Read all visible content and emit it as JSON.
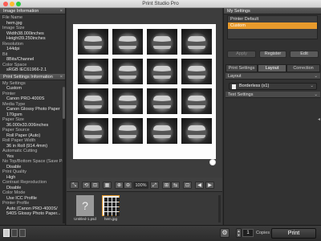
{
  "window": {
    "title": "Print Studio Pro"
  },
  "left_panel": {
    "image_info": {
      "heading": "Image Information",
      "close_label": "×",
      "rows": [
        {
          "label": "File Name",
          "value": "hem.jpg"
        },
        {
          "label": "Image Size",
          "value": "Width38.000inches"
        },
        {
          "label": "",
          "value": "Height39.250inches"
        },
        {
          "label": "Resolution",
          "value": "144dpi"
        },
        {
          "label": "Bit",
          "value": "8Bits/Channel"
        },
        {
          "label": "Color Space",
          "value": "sRGB IEC61966-2.1"
        }
      ]
    },
    "print_settings_info": {
      "heading": "Print Settings Information",
      "close_label": "×",
      "rows": [
        {
          "label": "My Settings",
          "value": "Custom"
        },
        {
          "label": "Printer",
          "value": "Canon PRO-4000S"
        },
        {
          "label": "Media Type",
          "value": "Canon Glossy Photo Paper"
        },
        {
          "label": "",
          "value": "170gsm"
        },
        {
          "label": "Paper Size",
          "value": "36.000x33.006inches"
        },
        {
          "label": "Paper Source",
          "value": "Roll Paper (Auto)"
        },
        {
          "label": "Roll Paper Width",
          "value": "36 in Roll (914.4mm)"
        },
        {
          "label": "Automatic Cutting",
          "value": "Yes"
        },
        {
          "label": "No Top/Bottom Space (Save Paper)",
          "value": "Disable"
        },
        {
          "label": "Print Quality",
          "value": "High"
        },
        {
          "label": "Contrast Reproduction",
          "value": "Disable"
        },
        {
          "label": "Color Mode",
          "value": "Use ICC Profile"
        },
        {
          "label": "Printer Profile",
          "value": "Auto (Canon PRO-4000S/"
        },
        {
          "label": "",
          "value": "540S Glossy Photo Paper..."
        }
      ]
    }
  },
  "toolbar": {
    "zoom": "100%"
  },
  "thumbnails": [
    {
      "caption": "Untitled-1.psd",
      "kind": "unknown",
      "selected": false,
      "placeholder_glyph": "?"
    },
    {
      "caption": "hem.jpg",
      "kind": "grid",
      "selected": true
    }
  ],
  "right_panel": {
    "my_settings": {
      "heading": "My Settings",
      "items": [
        "Printer Default",
        "Custom"
      ],
      "selected_index": 1,
      "buttons": {
        "apply": "Apply",
        "register": "Register",
        "edit": "Edit"
      }
    },
    "tabs": [
      "Print Settings",
      "Layout",
      "Correction"
    ],
    "active_tab": "Layout",
    "layout_section": "Layout",
    "layout_mode": "Borderless (x1)",
    "text_settings_section": "Text Settings"
  },
  "bottom_bar": {
    "copies_value": "1",
    "copies_label": "Copies",
    "print_label": "Print"
  },
  "colors": {
    "accent": "#e89a2c",
    "panel_bg": "#323232",
    "canvas_bg": "#3d3d3d"
  }
}
